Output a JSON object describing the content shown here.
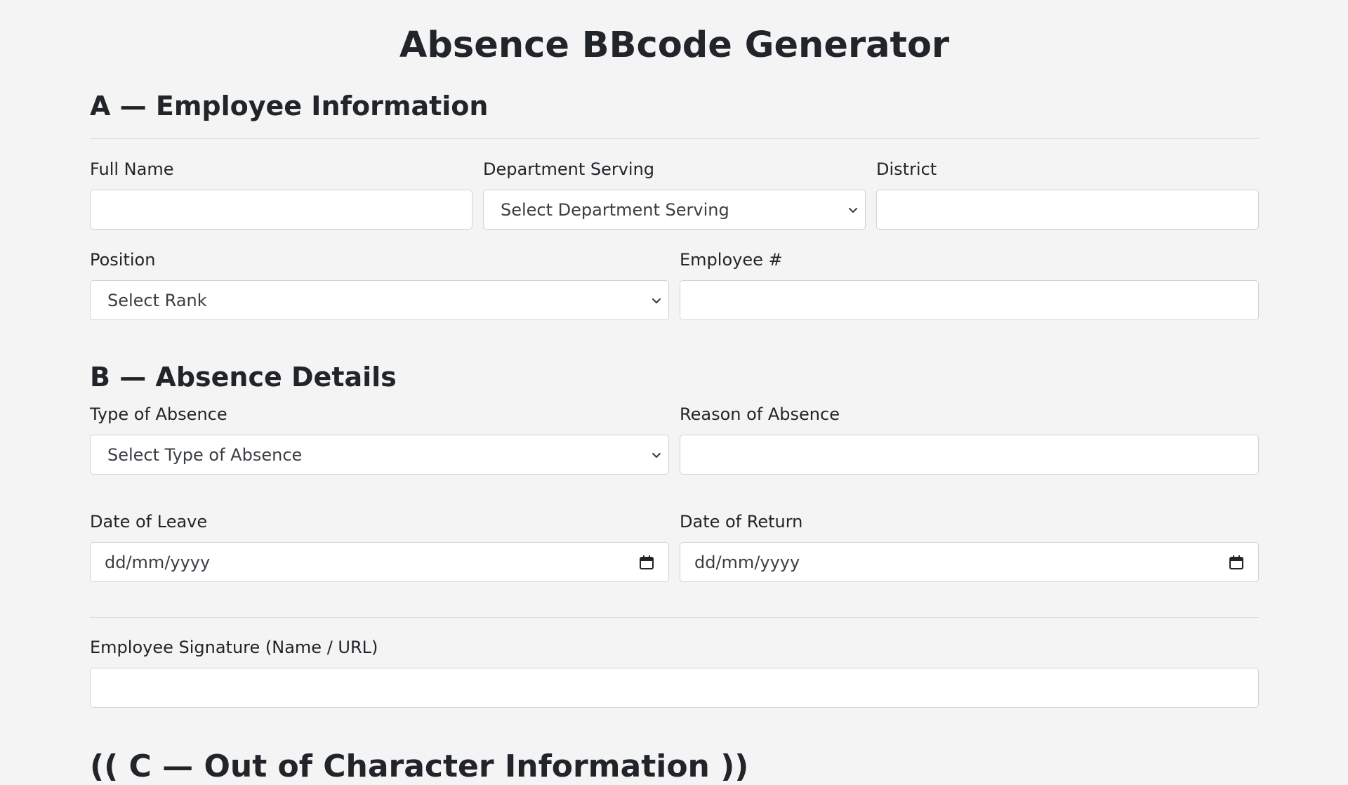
{
  "page": {
    "title": "Absence BBcode Generator"
  },
  "section_a": {
    "title": "A — Employee Information",
    "full_name": {
      "label": "Full Name",
      "value": ""
    },
    "department": {
      "label": "Department Serving",
      "selected": "Select Department Serving"
    },
    "district": {
      "label": "District",
      "value": ""
    },
    "position": {
      "label": "Position",
      "selected": "Select Rank"
    },
    "employee_number": {
      "label": "Employee #",
      "value": ""
    }
  },
  "section_b": {
    "title": "B — Absence Details",
    "type_of_absence": {
      "label": "Type of Absence",
      "selected": "Select Type of Absence"
    },
    "reason_of_absence": {
      "label": "Reason of Absence",
      "value": ""
    },
    "date_of_leave": {
      "label": "Date of Leave",
      "placeholder": "dd/mm/yyyy"
    },
    "date_of_return": {
      "label": "Date of Return",
      "placeholder": "dd/mm/yyyy"
    },
    "signature": {
      "label": "Employee Signature (Name / URL)",
      "value": ""
    }
  },
  "section_c": {
    "title": "(( C — Out of Character Information ))"
  },
  "icons": {
    "select_arrow": "chevron-down-icon",
    "date_picker": "calendar-icon"
  }
}
